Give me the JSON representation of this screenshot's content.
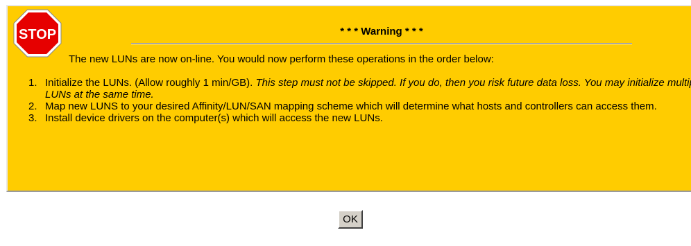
{
  "warning": {
    "stop_label": "STOP",
    "title": "* * * Warning * * *",
    "intro": "The new LUNs are now on-line. You would now perform these operations in the order below:",
    "steps": [
      {
        "num": "1.",
        "text": "Initialize the LUNs. (Allow roughly 1 min/GB). ",
        "italic": "This step must not be skipped. If you do, then you risk future data loss. You may initialize multiple LUNs at the same time."
      },
      {
        "num": "2.",
        "text": "Map new LUNS to your desired Affinity/LUN/SAN mapping scheme which will determine what hosts and controllers can access them."
      },
      {
        "num": "3.",
        "text": "Install device drivers on the computer(s) which will access the new LUNs."
      }
    ]
  },
  "dialog": {
    "ok_label": "OK"
  },
  "colors": {
    "panel_bg": "#ffcc00",
    "stop_red": "#e60000"
  },
  "icons": {
    "stop": "stop-sign-icon"
  }
}
